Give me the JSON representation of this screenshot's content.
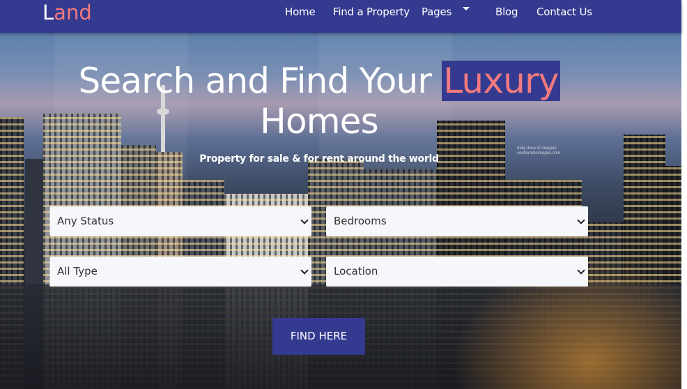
{
  "header": {
    "logo_first": "L",
    "logo_rest": "and",
    "nav": {
      "home": "Home",
      "find": "Find a Property",
      "pages": "Pages",
      "blog": "Blog",
      "contact": "Contact Us"
    }
  },
  "hero": {
    "title_pre": "Search and Find Your ",
    "title_accent": "Luxury",
    "title_post": "Homes",
    "subtitle": "Property for sale & for rent around the world"
  },
  "search": {
    "status": "Any Status",
    "bedrooms": "Bedrooms",
    "type": "All Type",
    "location": "Location",
    "button": "FIND HERE"
  },
  "watermark": {
    "line1": "daily dose of imagery",
    "line2": "cooltorontoimages.com"
  },
  "colors": {
    "brand": "#343a8f",
    "accent": "#f27a7e"
  },
  "icons": {
    "caret": "chevron-down-icon",
    "select_arrow": "chevron-down-icon"
  }
}
